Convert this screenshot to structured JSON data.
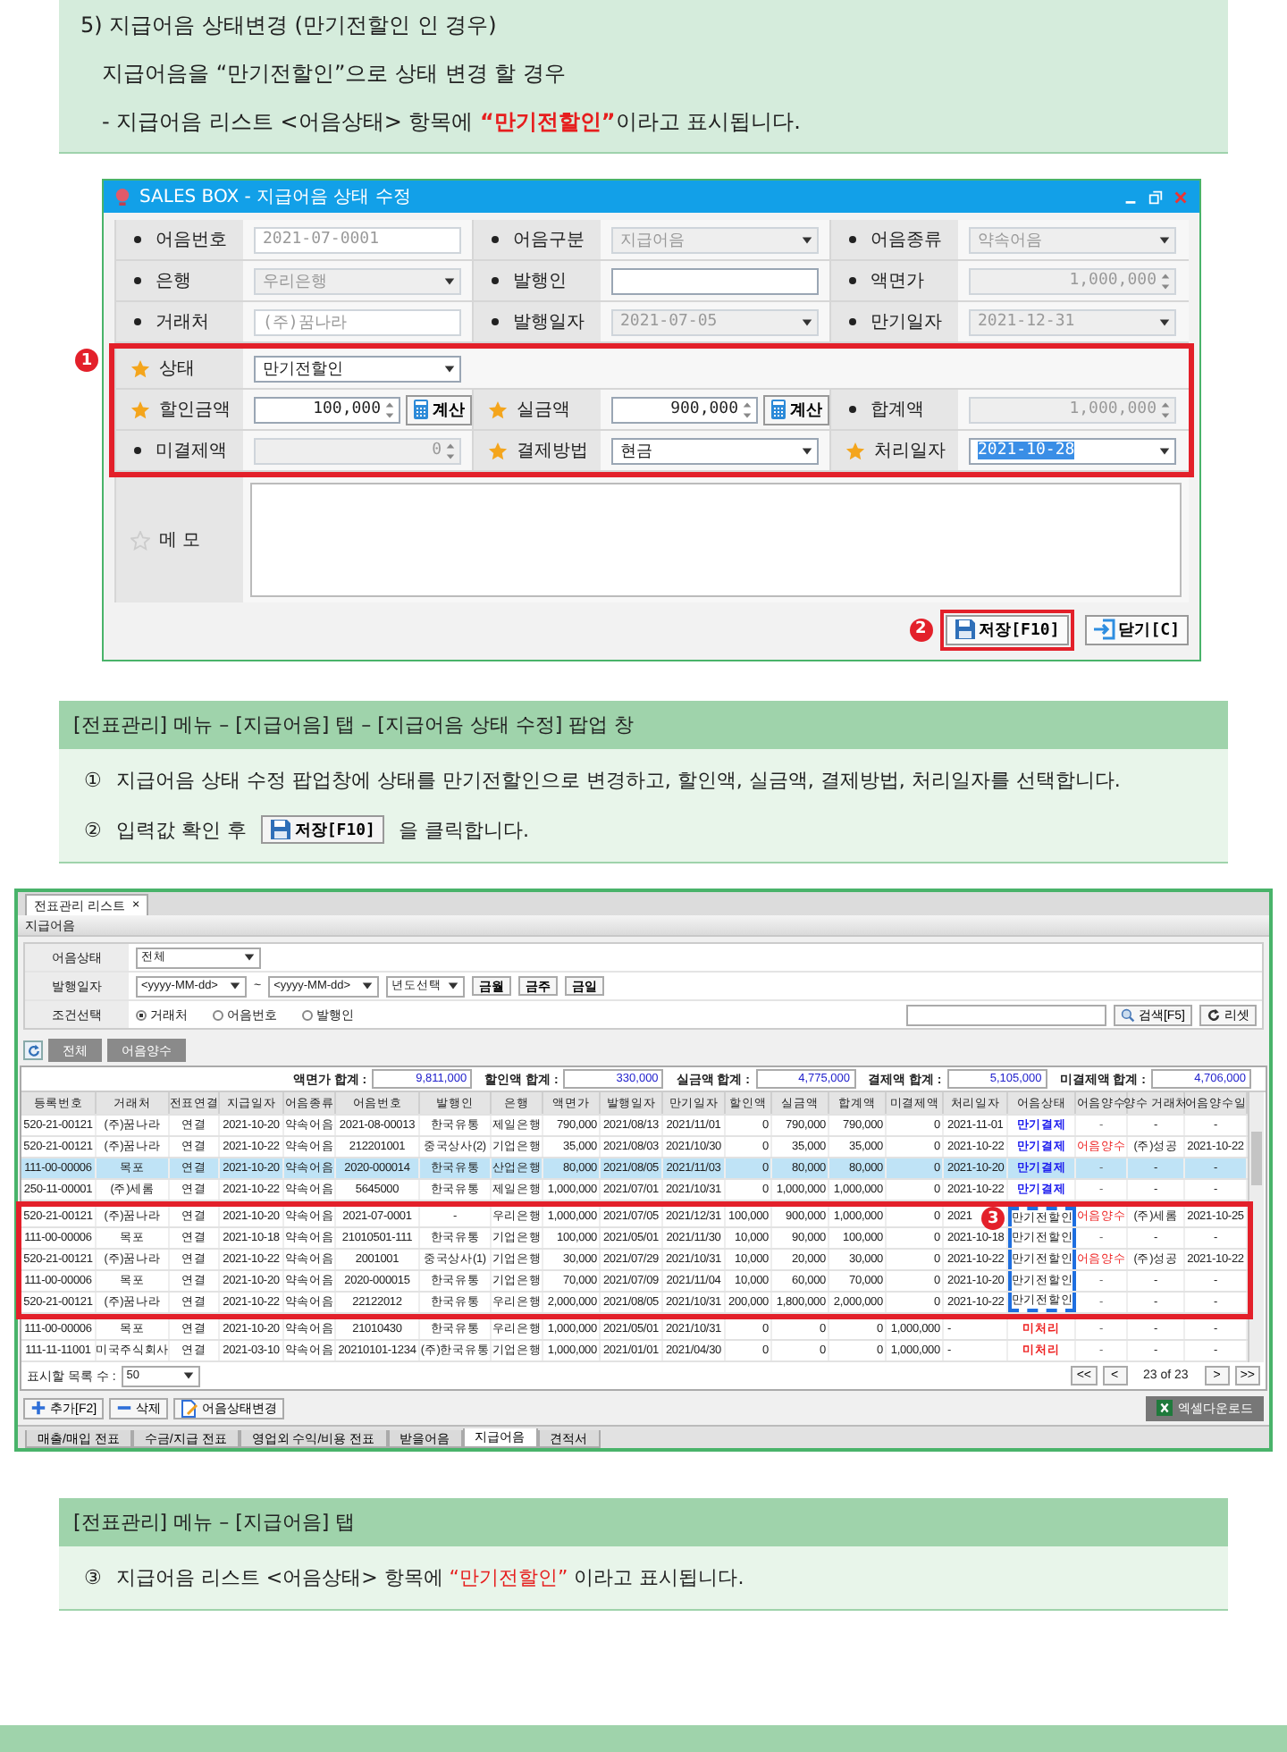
{
  "intro": {
    "heading": "5) 지급어음 상태변경 (만기전할인 인 경우)",
    "line": "지급어음을 “만기전할인”으로 상태 변경 할 경우",
    "note": [
      {
        "text": "- 지급어음 리스트 <어음상태> 항목에 ",
        "highlight": false
      },
      {
        "text": "“만기전할인”",
        "highlight": true
      },
      {
        "text": "이라고 표시됩니다.",
        "highlight": false
      }
    ]
  },
  "dialog": {
    "title": "SALES BOX - 지급어음 상태 수정",
    "rows": [
      [
        {
          "label": "어음번호",
          "required": false,
          "kind": "text",
          "value": "2021-07-0001",
          "disabled": true
        },
        {
          "label": "어음구분",
          "required": false,
          "kind": "select",
          "value": "지급어음",
          "disabled": true
        },
        {
          "label": "어음종류",
          "required": false,
          "kind": "select",
          "value": "약속어음",
          "disabled": true
        }
      ],
      [
        {
          "label": "은행",
          "required": false,
          "kind": "select",
          "value": "우리은행",
          "disabled": true
        },
        {
          "label": "발행인",
          "required": false,
          "kind": "text",
          "disabled": false
        },
        {
          "label": "액면가",
          "required": false,
          "kind": "spin",
          "value": "1,000,000",
          "disabled": true
        }
      ],
      [
        {
          "label": "거래처",
          "required": false,
          "kind": "text",
          "value": "(주)꿈나라",
          "disabled": true
        },
        {
          "label": "발행일자",
          "required": false,
          "kind": "select",
          "value": "2021-07-05",
          "disabled": true
        },
        {
          "label": "만기일자",
          "required": false,
          "kind": "select",
          "value": "2021-12-31",
          "disabled": true
        }
      ]
    ],
    "frame_badge": "1",
    "framed_rows": [
      [
        {
          "label": "상태",
          "required": true,
          "kind": "select",
          "value": "만기전할인",
          "disabled": false
        }
      ],
      [
        {
          "label": "할인금액",
          "required": true,
          "kind": "spin",
          "value": "100,000",
          "disabled": false,
          "button": "계산"
        },
        {
          "label": "실금액",
          "required": true,
          "kind": "spin",
          "value": "900,000",
          "disabled": false,
          "button": "계산"
        },
        {
          "label": "합계액",
          "required": false,
          "kind": "spin",
          "value": "1,000,000",
          "disabled": true
        }
      ],
      [
        {
          "label": "미결제액",
          "required": false,
          "kind": "spin",
          "value": "0",
          "disabled": true
        },
        {
          "label": "결제방법",
          "required": true,
          "kind": "select",
          "value": "현금",
          "disabled": false
        },
        {
          "label": "처리일자",
          "required": true,
          "kind": "select",
          "value": "2021-10-28",
          "disabled": false,
          "highlighted": true
        }
      ]
    ],
    "memo": {
      "label": "메 모",
      "kind": "optional"
    },
    "button_badge": "2",
    "buttons": [
      {
        "label": "저장[F10]",
        "kind": "save",
        "framed": true
      },
      {
        "label": "닫기[C]",
        "kind": "close",
        "framed": false
      }
    ]
  },
  "popup_section": {
    "title": "[전표관리] 메뉴 – [지급어음] 탭 – [지급어음 상태 수정] 팝업 창",
    "steps": [
      {
        "number": "①",
        "text": "지급어음 상태 수정 팝업창에 상태를 만기전할인으로 변경하고, 할인액, 실금액, 결제방법, 처리일자를 선택합니다."
      },
      {
        "number": "②",
        "text": "입력값 확인 후",
        "button": "저장[F10]",
        "after": "을  클릭합니다."
      }
    ]
  },
  "list_window": {
    "tab": {
      "label": "전표관리 리스트",
      "close": "×"
    },
    "section_title": "지급어음",
    "filters": {
      "status": {
        "label": "어음상태",
        "value": "전체"
      },
      "date": {
        "label": "발행일자",
        "from": "<yyyy-MM-dd>",
        "separator": "~",
        "to": "<yyyy-MM-dd>",
        "year": "년도선택",
        "quick": [
          "금월",
          "금주",
          "금일"
        ]
      },
      "condition": {
        "label": "조건선택",
        "options": [
          {
            "label": "거래처",
            "selected": true
          },
          {
            "label": "어음번호",
            "selected": false
          },
          {
            "label": "발행인",
            "selected": false
          }
        ]
      }
    },
    "search": {
      "button": "검색[F5]",
      "reset": "리셋"
    },
    "actions": [
      "전체",
      "어음양수"
    ],
    "totals": [
      {
        "label": "액면가 합계 :",
        "value": "9,811,000"
      },
      {
        "label": "할인액 합계 :",
        "value": "330,000"
      },
      {
        "label": "실금액 합계 :",
        "value": "4,775,000"
      },
      {
        "label": "결제액 합계 :",
        "value": "5,105,000"
      },
      {
        "label": "미결제액 합계 :",
        "value": "4,706,000"
      }
    ],
    "columns": [
      {
        "label": "등록번호",
        "kind": "text"
      },
      {
        "label": "거래처",
        "kind": "text"
      },
      {
        "label": "전표연결",
        "kind": "text"
      },
      {
        "label": "지급일자",
        "kind": "text"
      },
      {
        "label": "어음종류",
        "kind": "text"
      },
      {
        "label": "어음번호",
        "kind": "text"
      },
      {
        "label": "발행인",
        "kind": "text"
      },
      {
        "label": "은행",
        "kind": "text"
      },
      {
        "label": "액면가",
        "kind": "num"
      },
      {
        "label": "발행일자",
        "kind": "text"
      },
      {
        "label": "만기일자",
        "kind": "text"
      },
      {
        "label": "할인액",
        "kind": "num"
      },
      {
        "label": "실금액",
        "kind": "num"
      },
      {
        "label": "합계액",
        "kind": "num"
      },
      {
        "label": "미결제액",
        "kind": "num"
      },
      {
        "label": "처리일자",
        "kind": "date"
      },
      {
        "label": "어음상태",
        "kind": "status"
      },
      {
        "label": "어음양수",
        "kind": "transfer"
      },
      {
        "label": "양수 거래처",
        "kind": "text"
      },
      {
        "label": "어음양수일",
        "kind": "text"
      }
    ],
    "rows": [
      {
        "cells": [
          "520-21-00121",
          "(주)꿈나라",
          "연결",
          "2021-10-20",
          "약속어음",
          "2021-08-00013",
          "한국유통",
          "제일은행",
          "790,000",
          "2021/08/13",
          "2021/11/01",
          "0",
          "790,000",
          "790,000",
          "0",
          "2021-11-01",
          {
            "text": "만기결제",
            "color": "#1a1aee",
            "bold": true
          },
          "-",
          "-",
          "-"
        ],
        "selected": false
      },
      {
        "cells": [
          "520-21-00121",
          "(주)꿈나라",
          "연결",
          "2021-10-22",
          "약속어음",
          "212201001",
          "중국상사(2)",
          "기업은행",
          "35,000",
          "2021/08/03",
          "2021/10/30",
          "0",
          "35,000",
          "35,000",
          "0",
          "2021-10-22",
          {
            "text": "만기결제",
            "color": "#1a1aee",
            "bold": true
          },
          {
            "text": "어음양수",
            "color": "#ee2222",
            "bold": false
          },
          "(주)성공",
          "2021-10-22"
        ],
        "selected": false
      },
      {
        "cells": [
          "111-00-00006",
          "목포",
          "연결",
          "2021-10-20",
          "약속어음",
          "2020-000014",
          "한국유통",
          "산업은행",
          "80,000",
          "2021/08/05",
          "2021/11/03",
          "0",
          "80,000",
          "80,000",
          "0",
          "2021-10-20",
          {
            "text": "만기결제",
            "color": "#1a1aee",
            "bold": true
          },
          "-",
          "-",
          "-"
        ],
        "selected": true
      },
      {
        "cells": [
          "250-11-00001",
          "(주)세롬",
          "연결",
          "2021-10-22",
          "약속어음",
          "5645000",
          "한국유통",
          "제일은행",
          "1,000,000",
          "2021/07/01",
          "2021/10/31",
          "0",
          "1,000,000",
          "1,000,000",
          "0",
          "2021-10-22",
          {
            "text": "만기결제",
            "color": "#1a1aee",
            "bold": true
          },
          "-",
          "-",
          "-"
        ],
        "selected": false
      }
    ],
    "frame_badge": "3",
    "framed_rows": [
      {
        "cells": [
          "520-21-00121",
          "(주)꿈나라",
          "연결",
          "2021-10-20",
          "약속어음",
          "2021-07-0001",
          "-",
          "우리은행",
          "1,000,000",
          "2021/07/05",
          "2021/12/31",
          "100,000",
          "900,000",
          "1,000,000",
          "0",
          "2021",
          {
            "text": "만기전할인",
            "color": "#222222",
            "bold": false
          },
          {
            "text": "어음양수",
            "color": "#ee2222",
            "bold": false
          },
          "(주)세롬",
          "2021-10-25"
        ],
        "selected": false
      },
      {
        "cells": [
          "111-00-00006",
          "목포",
          "연결",
          "2021-10-18",
          "약속어음",
          "21010501-111",
          "한국유통",
          "기업은행",
          "100,000",
          "2021/05/01",
          "2021/11/30",
          "10,000",
          "90,000",
          "100,000",
          "0",
          "2021-10-18",
          {
            "text": "만기전할인",
            "color": "#222222",
            "bold": false
          },
          "-",
          "-",
          "-"
        ],
        "selected": false
      },
      {
        "cells": [
          "520-21-00121",
          "(주)꿈나라",
          "연결",
          "2021-10-22",
          "약속어음",
          "2001001",
          "중국상사(1)",
          "기업은행",
          "30,000",
          "2021/07/29",
          "2021/10/31",
          "10,000",
          "20,000",
          "30,000",
          "0",
          "2021-10-22",
          {
            "text": "만기전할인",
            "color": "#222222",
            "bold": false
          },
          {
            "text": "어음양수",
            "color": "#ee2222",
            "bold": false
          },
          "(주)성공",
          "2021-10-22"
        ],
        "selected": false
      },
      {
        "cells": [
          "111-00-00006",
          "목포",
          "연결",
          "2021-10-20",
          "약속어음",
          "2020-000015",
          "한국유통",
          "기업은행",
          "70,000",
          "2021/07/09",
          "2021/11/04",
          "10,000",
          "60,000",
          "70,000",
          "0",
          "2021-10-20",
          {
            "text": "만기전할인",
            "color": "#222222",
            "bold": false
          },
          "-",
          "-",
          "-"
        ],
        "selected": false
      },
      {
        "cells": [
          "520-21-00121",
          "(주)꿈나라",
          "연결",
          "2021-10-22",
          "약속어음",
          "22122012",
          "한국유통",
          "우리은행",
          "2,000,000",
          "2021/08/05",
          "2021/10/31",
          "200,000",
          "1,800,000",
          "2,000,000",
          "0",
          "2021-10-22",
          {
            "text": "만기전할인",
            "color": "#222222",
            "bold": false
          },
          "-",
          "-",
          "-"
        ],
        "selected": false
      }
    ],
    "rows_after": [
      {
        "cells": [
          "111-00-00006",
          "목포",
          "연결",
          "2021-10-20",
          "약속어음",
          "21010430",
          "한국유통",
          "우리은행",
          "1,000,000",
          "2021/05/01",
          "2021/10/31",
          "0",
          "0",
          "0",
          "1,000,000",
          "-",
          {
            "text": "미처리",
            "color": "#ee2222",
            "bold": true
          },
          "-",
          "-",
          "-"
        ],
        "selected": false
      },
      {
        "cells": [
          "111-11-11001",
          "미국주식회사",
          "연결",
          "2021-03-10",
          "약속어음",
          "20210101-1234",
          "(주)한국유통",
          "기업은행",
          "1,000,000",
          "2021/01/01",
          "2021/04/30",
          "0",
          "0",
          "0",
          "1,000,000",
          "-",
          {
            "text": "미처리",
            "color": "#ee2222",
            "bold": true
          },
          "-",
          "-",
          "-"
        ],
        "selected": false
      }
    ],
    "page_size": {
      "label": "표시할 목록 수 :",
      "value": "50"
    },
    "pager": {
      "first": "<<",
      "prev": "<",
      "status": "23 of 23",
      "next": ">",
      "last": ">>"
    },
    "excel": "엑셀다운로드",
    "bottom_buttons": [
      {
        "label": "추가[F2]",
        "kind": "add"
      },
      {
        "label": "삭제",
        "kind": "delete"
      },
      {
        "label": "어음상태변경",
        "kind": "edit"
      }
    ],
    "tabs": [
      {
        "label": "매출/매입 전표",
        "selected": false
      },
      {
        "label": "수금/지급 전표",
        "selected": false
      },
      {
        "label": "영업외 수익/비용 전표",
        "selected": false
      },
      {
        "label": "받을어음",
        "selected": false
      },
      {
        "label": "지급어음",
        "selected": true
      },
      {
        "label": "견적서",
        "selected": false
      }
    ]
  },
  "list_section": {
    "title": "[전표관리] 메뉴 – [지급어음] 탭",
    "steps": [
      {
        "number": "③",
        "parts": [
          {
            "text": "지급어음 리스트 <어음상태> 항목에 ",
            "highlight": false
          },
          {
            "text": "“만기전할인”",
            "highlight": true
          },
          {
            "text": " 이라고 표시됩니다.",
            "highlight": false
          }
        ]
      }
    ]
  }
}
